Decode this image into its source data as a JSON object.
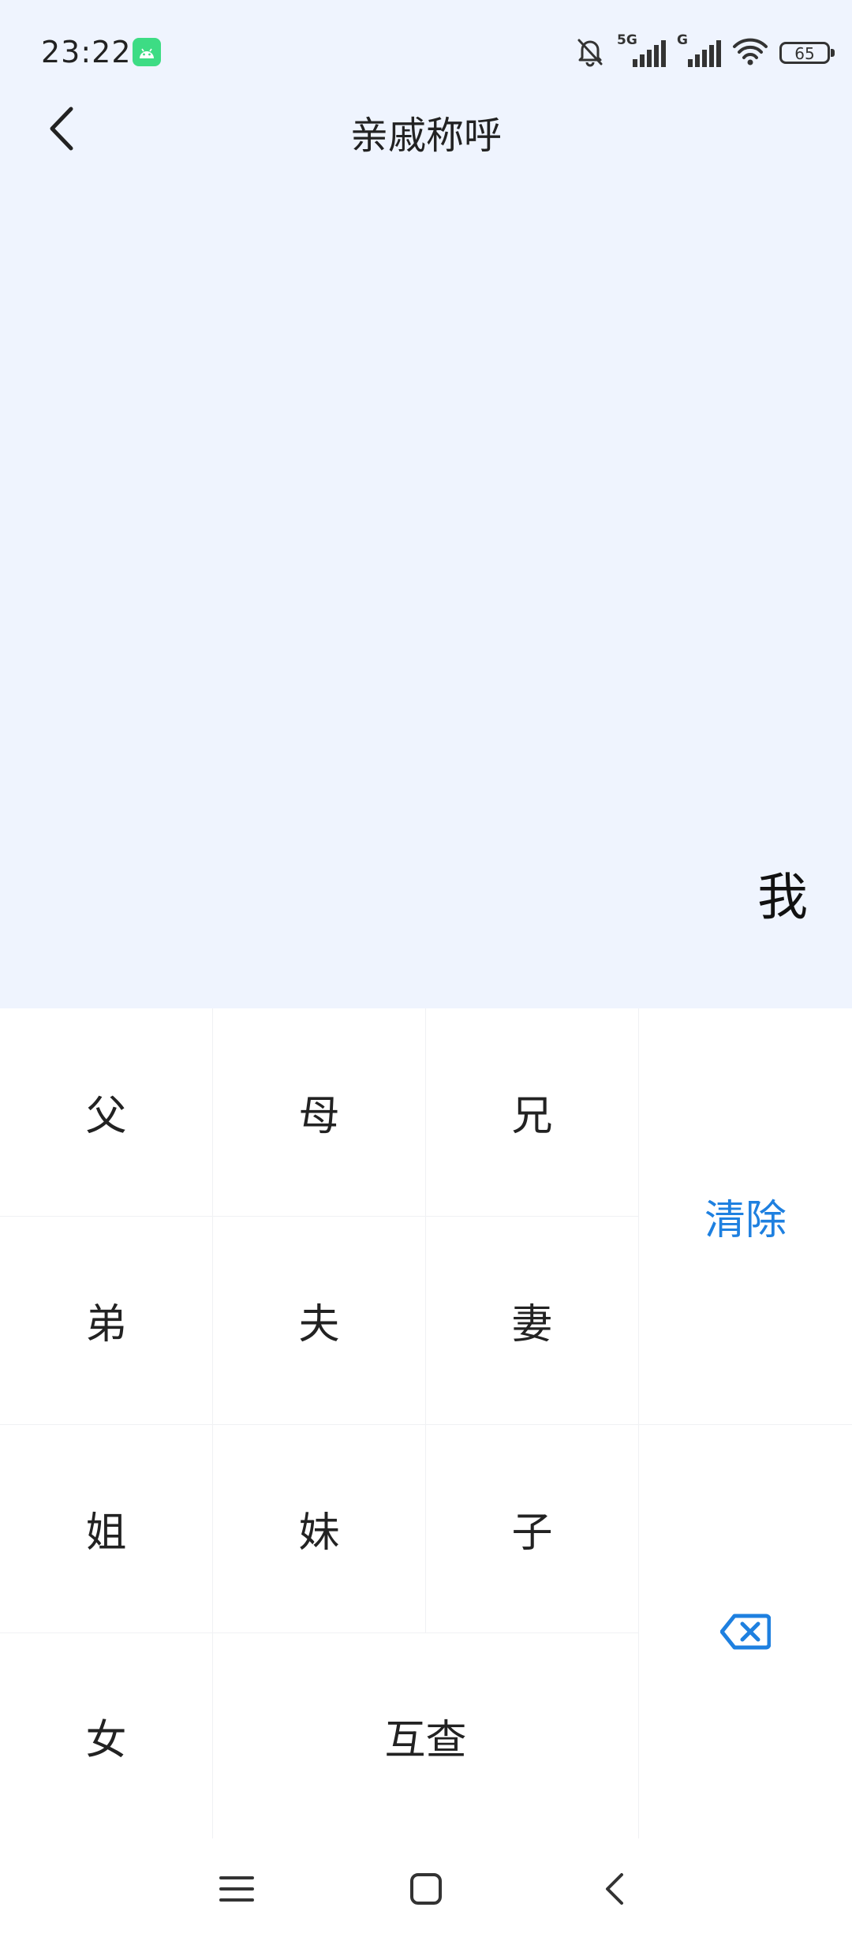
{
  "status_bar": {
    "time": "23:22",
    "network_1": "5G",
    "network_2": "G",
    "battery": "65"
  },
  "header": {
    "title": "亲戚称呼"
  },
  "display": {
    "value": "我"
  },
  "keypad": {
    "keys": [
      "父",
      "母",
      "兄",
      "弟",
      "夫",
      "妻",
      "姐",
      "妹",
      "子",
      "女"
    ],
    "swap_label": "互查",
    "clear_label": "清除"
  },
  "colors": {
    "background": "#EFF4FE",
    "accent": "#1E80E0"
  }
}
